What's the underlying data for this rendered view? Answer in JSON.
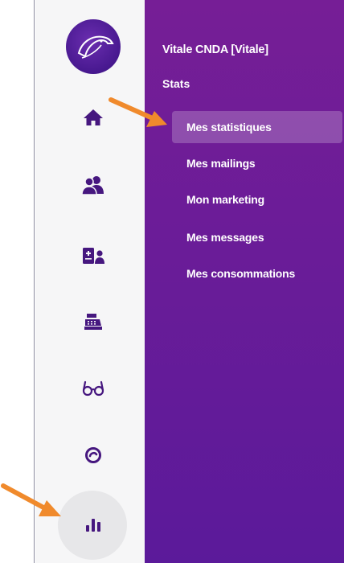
{
  "org": {
    "name": "Vitale CNDA [Vitale]"
  },
  "section": {
    "title": "Stats"
  },
  "menu": {
    "items": [
      {
        "label": "Mes statistiques",
        "active": true
      },
      {
        "label": "Mes mailings"
      },
      {
        "label": "Mon marketing"
      },
      {
        "label": "Mes messages"
      },
      {
        "label": "Mes consommations"
      }
    ]
  },
  "rail": {
    "icons": [
      "home-icon",
      "users-icon",
      "patient-card-icon",
      "cash-register-icon",
      "glasses-icon",
      "eye-icon",
      "stats-bars-icon"
    ],
    "active": "stats-bars-icon"
  },
  "colors": {
    "panel_top": "#761e96",
    "panel_bottom": "#5b1a9a",
    "rail_icon": "#46177f",
    "arrow": "#f08a2c",
    "rail_bg": "#f6f6f7"
  }
}
